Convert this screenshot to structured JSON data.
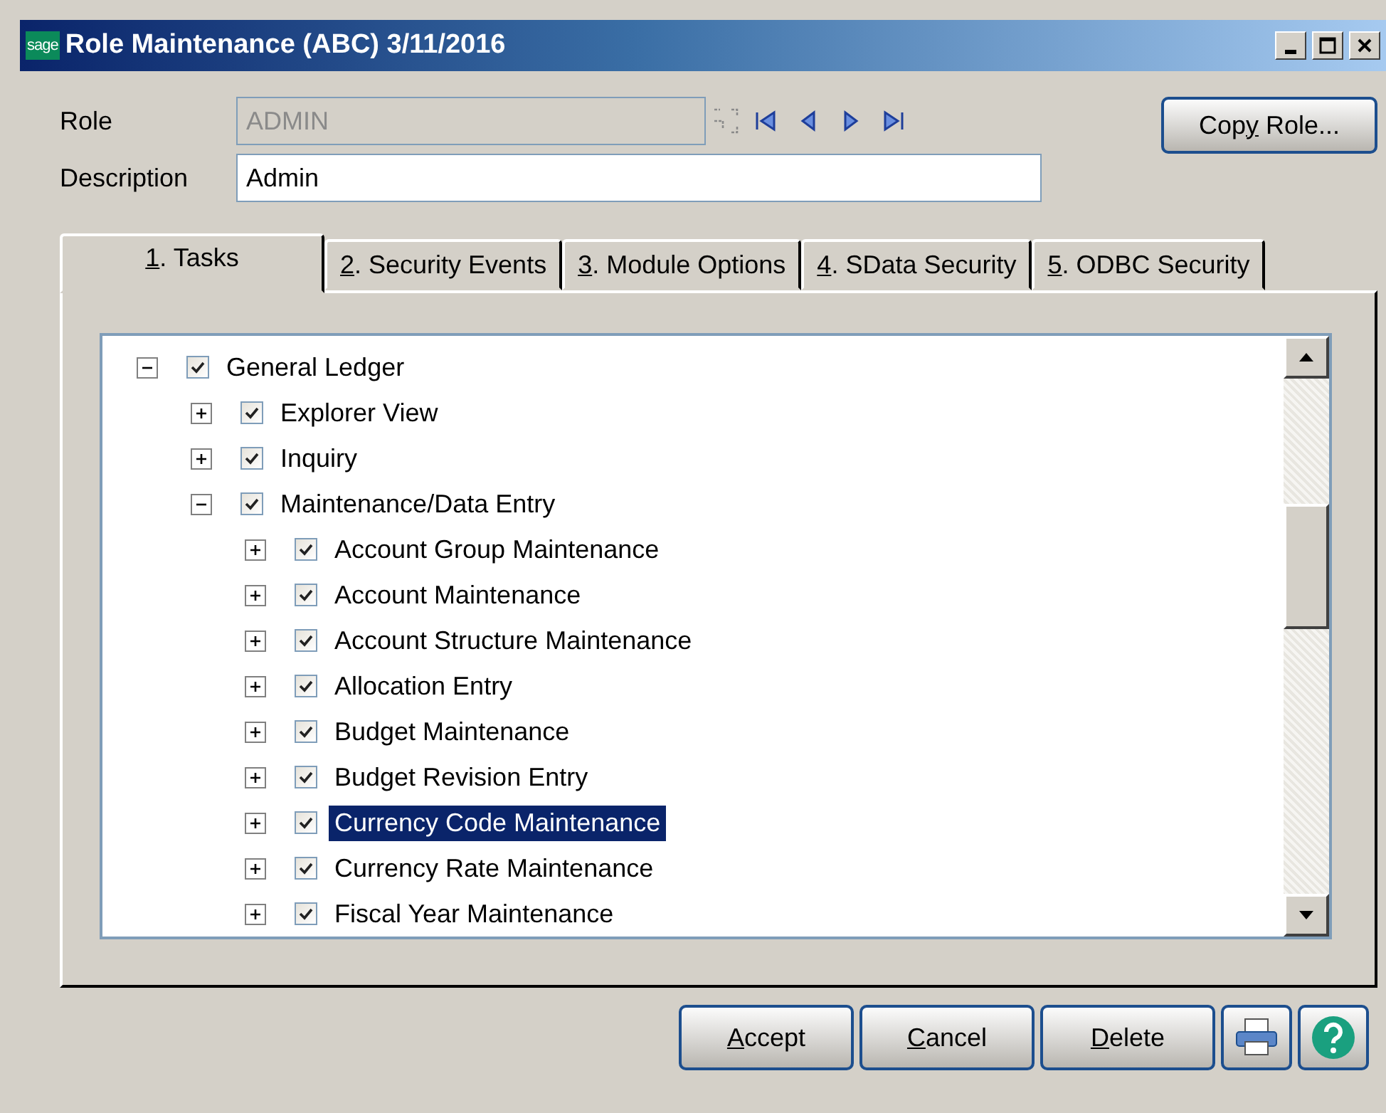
{
  "window": {
    "title": "Role Maintenance (ABC) 3/11/2016",
    "logo": "sage"
  },
  "form": {
    "role": {
      "label": "Role",
      "value": "ADMIN",
      "disabled": true
    },
    "description": {
      "label": "Description",
      "value": "Admin"
    },
    "copy_button": {
      "label": {
        "before": "Cop",
        "access_key": "y",
        "after": " Role..."
      }
    }
  },
  "tabs": [
    {
      "label": {
        "access_key": "1",
        "after": ". Tasks"
      },
      "selected": true
    },
    {
      "label": {
        "access_key": "2",
        "after": ". Security Events"
      },
      "selected": false
    },
    {
      "label": {
        "access_key": "3",
        "after": ". Module Options"
      },
      "selected": false
    },
    {
      "label": {
        "access_key": "4",
        "after": ". SData Security"
      },
      "selected": false
    },
    {
      "label": {
        "access_key": "5",
        "after": ". ODBC Security"
      },
      "selected": false
    }
  ],
  "tree": [
    {
      "label": "General Ledger",
      "checked": true,
      "expanded": true,
      "selected": false,
      "children": [
        {
          "label": "Explorer View",
          "checked": true,
          "expanded": false,
          "selected": false
        },
        {
          "label": "Inquiry",
          "checked": true,
          "expanded": false,
          "selected": false
        },
        {
          "label": "Maintenance/Data Entry",
          "checked": true,
          "expanded": true,
          "selected": false,
          "children": [
            {
              "label": "Account Group Maintenance",
              "checked": true,
              "expanded": false,
              "selected": false
            },
            {
              "label": "Account Maintenance",
              "checked": true,
              "expanded": false,
              "selected": false
            },
            {
              "label": "Account Structure Maintenance",
              "checked": true,
              "expanded": false,
              "selected": false
            },
            {
              "label": "Allocation Entry",
              "checked": true,
              "expanded": false,
              "selected": false
            },
            {
              "label": "Budget Maintenance",
              "checked": true,
              "expanded": false,
              "selected": false
            },
            {
              "label": "Budget Revision Entry",
              "checked": true,
              "expanded": false,
              "selected": false
            },
            {
              "label": "Currency Code Maintenance",
              "checked": true,
              "expanded": false,
              "selected": true
            },
            {
              "label": "Currency Rate Maintenance",
              "checked": true,
              "expanded": false,
              "selected": false
            },
            {
              "label": "Fiscal Year Maintenance",
              "checked": true,
              "expanded": false,
              "selected": false
            }
          ]
        }
      ]
    }
  ],
  "buttons": [
    {
      "label": {
        "access_key": "A",
        "after": "ccept"
      }
    },
    {
      "label": {
        "access_key": "C",
        "after": "ancel"
      }
    },
    {
      "label": {
        "access_key": "D",
        "after": "elete"
      }
    }
  ]
}
